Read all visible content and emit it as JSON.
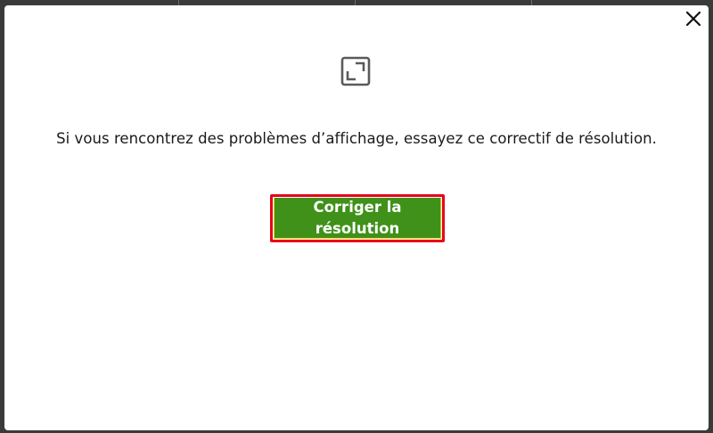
{
  "dialog": {
    "close_label": "Close",
    "icon": "fullscreen-exit-icon",
    "message": "Si vous rencontrez des problèmes d’affichage, essayez ce correctif de résolution.",
    "fix_button_label": "Corriger la résolution"
  },
  "colors": {
    "backdrop": "#3a3a3a",
    "dialog_bg": "#ffffff",
    "button_green": "#3f9119",
    "highlight_red": "#e8001a"
  }
}
